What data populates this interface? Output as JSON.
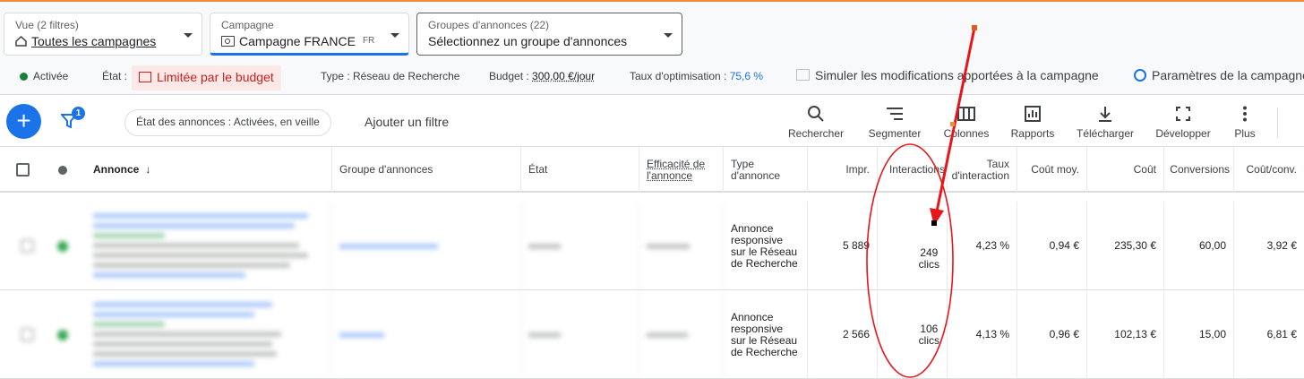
{
  "selectors": {
    "view": {
      "label": "Vue (2 filtres)",
      "value": "Toutes les campagnes"
    },
    "campaign": {
      "label": "Campagne",
      "value": "Campagne FRANCE",
      "suffix": "FR"
    },
    "adgroups": {
      "label": "Groupes d'annonces (22)",
      "value": "Sélectionnez un groupe d'annonces"
    }
  },
  "status": {
    "active": "Activée",
    "state_label": "État :",
    "state_value": "Limitée par le budget",
    "type": "Type : Réseau de Recherche",
    "budget_label": "Budget :",
    "budget_value": "300,00 €/jour",
    "opti_label": "Taux d'optimisation :",
    "opti_value": "75,6 %",
    "simulate": "Simuler les modifications apportées à la campagne",
    "params": "Paramètres de la campagne"
  },
  "toolbar": {
    "filter_badge": "1",
    "chip": "État des annonces : Activées, en veille",
    "add_filter": "Ajouter un filtre",
    "tools": [
      {
        "label": "Rechercher",
        "icon": "search-icon"
      },
      {
        "label": "Segmenter",
        "icon": "segment-icon"
      },
      {
        "label": "Colonnes",
        "icon": "columns-icon"
      },
      {
        "label": "Rapports",
        "icon": "reports-icon"
      },
      {
        "label": "Télécharger",
        "icon": "download-icon"
      },
      {
        "label": "Développer",
        "icon": "expand-icon"
      },
      {
        "label": "Plus",
        "icon": "more-vert-icon"
      }
    ]
  },
  "table": {
    "headers": {
      "ad": "Annonce",
      "adgroup": "Groupe d'annonces",
      "state": "État",
      "efficacy": "Efficacité de l'annonce",
      "adtype": "Type d'annonce",
      "impr": "Impr.",
      "interactions": "Interactions",
      "rate": "Taux d'interaction",
      "avgcost": "Coût moy.",
      "cost": "Coût",
      "conversions": "Conversions",
      "costconv": "Coût/conv."
    },
    "rows": [
      {
        "adtype": "Annonce responsive sur le Réseau de Recherche",
        "impr": "5 889",
        "interactions": "249",
        "interactions_unit": "clics",
        "rate": "4,23 %",
        "avgcost": "0,94 €",
        "cost": "235,30 €",
        "conversions": "60,00",
        "costconv": "3,92 €"
      },
      {
        "adtype": "Annonce responsive sur le Réseau de Recherche",
        "impr": "2 566",
        "interactions": "106",
        "interactions_unit": "clics",
        "rate": "4,13 %",
        "avgcost": "0,96 €",
        "cost": "102,13 €",
        "conversions": "15,00",
        "costconv": "6,81 €"
      }
    ]
  },
  "colors": {
    "accent": "#1a73e8",
    "annotation": "#e8161b",
    "warning_bg": "#fce8e6",
    "warning_text": "#c5221f"
  }
}
